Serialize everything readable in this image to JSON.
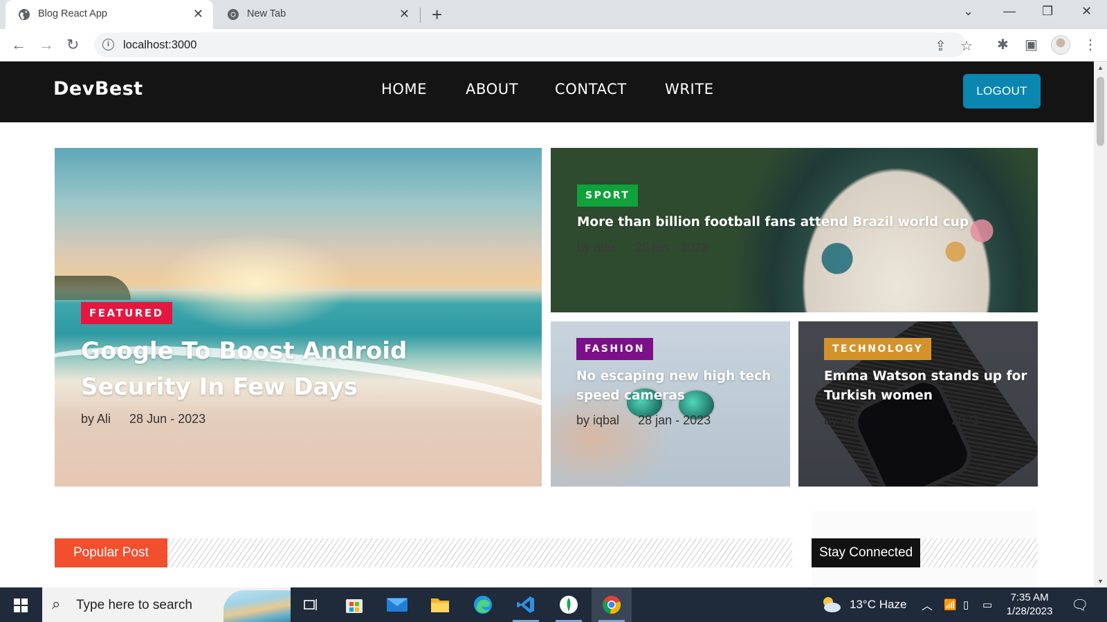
{
  "browser": {
    "tabs": [
      {
        "title": "Blog React App",
        "active": true
      },
      {
        "title": "New Tab",
        "active": false
      }
    ],
    "url": "localhost:3000"
  },
  "site": {
    "logo": "DevBest",
    "nav": [
      "HOME",
      "ABOUT",
      "CONTACT",
      "WRITE"
    ],
    "logout_label": "LOGOUT"
  },
  "featured": {
    "badge": "FEATURED",
    "badge_color": "#e5173f",
    "title": "Google To Boost Android Security In Few Days",
    "author": "by Ali",
    "date": "28 Jun - 2023"
  },
  "posts": [
    {
      "badge": "SPORT",
      "badge_color": "#0fa13a",
      "title": "More than billion football fans attend Brazil world cup",
      "author": "by alex",
      "date": "28 jan - 2023"
    },
    {
      "badge": "FASHION",
      "badge_color": "#7b1089",
      "title": "No escaping new high tech speed cameras",
      "author": "by iqbal",
      "date": "28 jan - 2023"
    },
    {
      "badge": "TECHNOLOGY",
      "badge_color": "#d4932a",
      "title": "Emma Watson stands up for Turkish women",
      "author": "by wo",
      "date": "2023"
    }
  ],
  "sections": {
    "popular": {
      "label": "Popular Post",
      "color": "#f24f2f"
    },
    "connected": {
      "label": "Stay Connected",
      "color": "#111111"
    }
  },
  "taskbar": {
    "search_placeholder": "Type here to search",
    "weather": "13°C  Haze",
    "time": "7:35 AM",
    "date": "1/28/2023"
  }
}
